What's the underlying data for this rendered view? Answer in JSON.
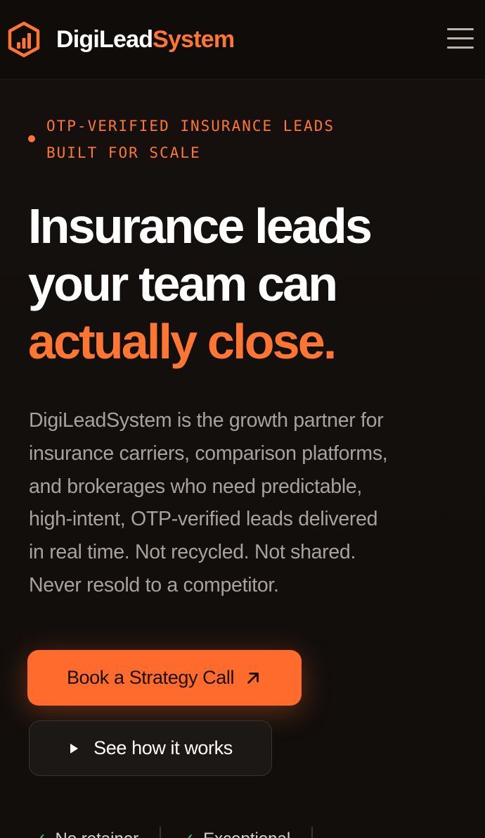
{
  "header": {
    "brand_primary": "DigiLead",
    "brand_accent": "System",
    "logo_icon": "bar-chart-hexagon-icon",
    "menu_icon": "hamburger-menu-icon"
  },
  "hero": {
    "eyebrow": [
      "OTP-VERIFIED INSURANCE LEADS",
      "BUILT FOR SCALE"
    ],
    "headline_line1": "Insurance leads",
    "headline_line2": "your team can",
    "headline_accent": "actually close.",
    "lede": [
      "DigiLeadSystem is the growth partner for",
      "insurance carriers, comparison platforms,",
      "and brokerages who need predictable,",
      "high-intent, OTP-verified leads delivered",
      "in real time. Not recycled. Not shared.",
      "Never resold to a competitor."
    ],
    "primary_cta": "Book a Strategy Call",
    "secondary_cta": "See how it works"
  },
  "trust": {
    "items": [
      "No retainer",
      "Exceptional"
    ]
  },
  "colors": {
    "accent": "#ff7633",
    "button": "#ff6b2c",
    "background": "#130f0d",
    "check": "#3fbf6a"
  }
}
